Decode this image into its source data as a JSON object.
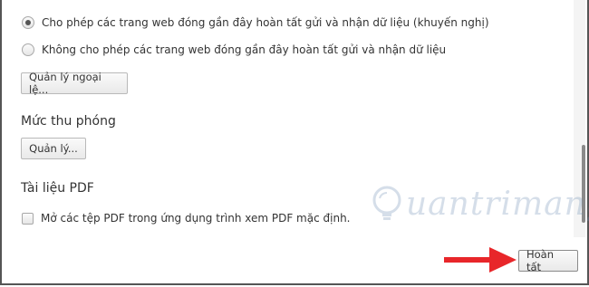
{
  "privacy": {
    "radio_allow": "Cho phép các trang web đóng gần đây hoàn tất gửi và nhận dữ liệu (khuyến nghị)",
    "radio_deny": "Không cho phép các trang web đóng gần đây hoàn tất gửi và nhận dữ liệu",
    "manage_exceptions_button": "Quản lý ngoại lệ..."
  },
  "zoom": {
    "title": "Mức thu phóng",
    "manage_button": "Quản lý..."
  },
  "pdf": {
    "title": "Tài liệu PDF",
    "checkbox_label": "Mở các tệp PDF trong ứng dụng trình xem PDF mặc định."
  },
  "footer": {
    "done_button": "Hoàn tất"
  },
  "watermark": {
    "text": "uantrimang"
  },
  "colors": {
    "arrow": "#e8262a",
    "watermark": "#6c8db3"
  }
}
